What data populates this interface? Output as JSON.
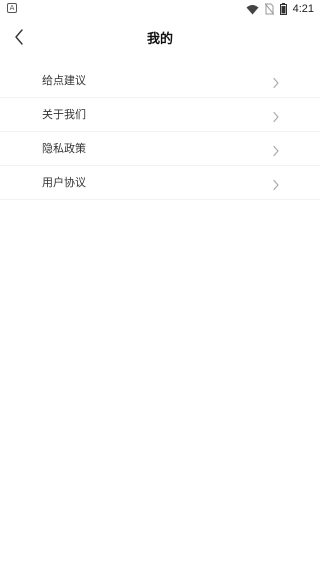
{
  "status_bar": {
    "app_indicator": "A",
    "time": "4:21"
  },
  "header": {
    "title": "我的"
  },
  "menu": {
    "items": [
      {
        "label": "给点建议"
      },
      {
        "label": "关于我们"
      },
      {
        "label": "隐私政策"
      },
      {
        "label": "用户协议"
      }
    ]
  },
  "icons": {
    "back": "chevron-left-icon",
    "item_arrow": "chevron-right-icon",
    "wifi": "wifi-icon",
    "no_sim": "no-sim-icon",
    "battery": "battery-icon"
  }
}
